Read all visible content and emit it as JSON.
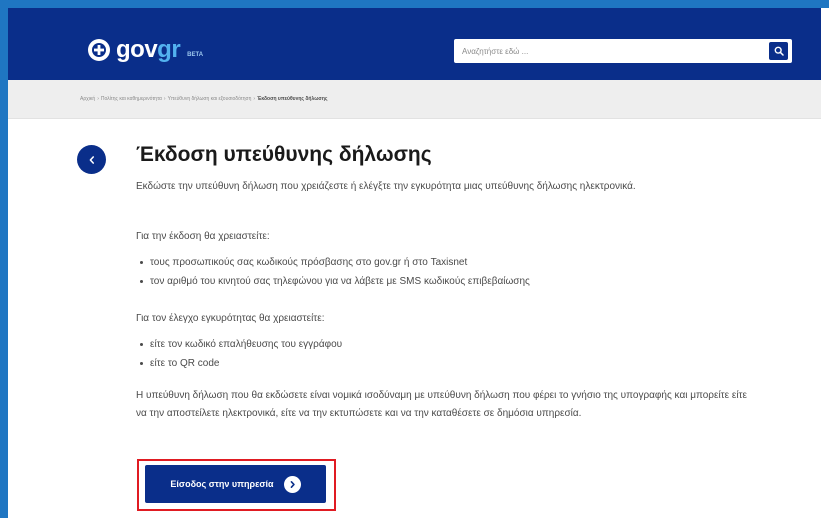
{
  "header": {
    "logo_text_main": "gov",
    "logo_text_accent": "gr",
    "logo_badge": "BETA",
    "search_placeholder": "Αναζητήστε εδώ ...",
    "search_icon": "search-icon"
  },
  "breadcrumb": {
    "items": [
      "Αρχική",
      "Πολίτης και καθημερινότητα",
      "Υπεύθυνη δήλωση και εξουσιοδότηση",
      "Έκδοση υπεύθυνης δήλωσης"
    ],
    "separator": "›"
  },
  "main": {
    "back_icon": "chevron-left-icon",
    "title": "Έκδοση υπεύθυνης δήλωσης",
    "intro": "Εκδώστε την υπεύθυνη δήλωση που χρειάζεστε ή ελέγξτε την εγκυρότητα μιας υπεύθυνης δήλωσης ηλεκτρονικά.",
    "requirements_title": "Για την έκδοση θα χρειαστείτε:",
    "requirements": [
      "τους προσωπικούς σας κωδικούς πρόσβασης στο gov.gr ή στο Taxisnet",
      "τον αριθμό του κινητού σας τηλεφώνου για να λάβετε με SMS κωδικούς επιβεβαίωσης"
    ],
    "verification_title": "Για τον έλεγχο εγκυρότητας θα χρειαστείτε:",
    "verification": [
      "είτε τον κωδικό επαλήθευσης του εγγράφου",
      "είτε το QR code"
    ],
    "legal_note": "Η υπεύθυνη δήλωση που θα εκδώσετε είναι νομικά ισοδύναμη με υπεύθυνη δήλωση που φέρει το γνήσιο της υπογραφής και μπορείτε είτε να την αποστείλετε ηλεκτρονικά, είτε να την εκτυπώσετε και να την καταθέσετε σε δημόσια υπηρεσία.",
    "cta_label": "Είσοδος στην υπηρεσία",
    "cta_icon": "chevron-right-icon"
  },
  "colors": {
    "brand_navy": "#0a2e8a",
    "frame_blue": "#1f76c2",
    "accent_light_blue": "#53b2ef",
    "highlight_red": "#e01b22"
  }
}
